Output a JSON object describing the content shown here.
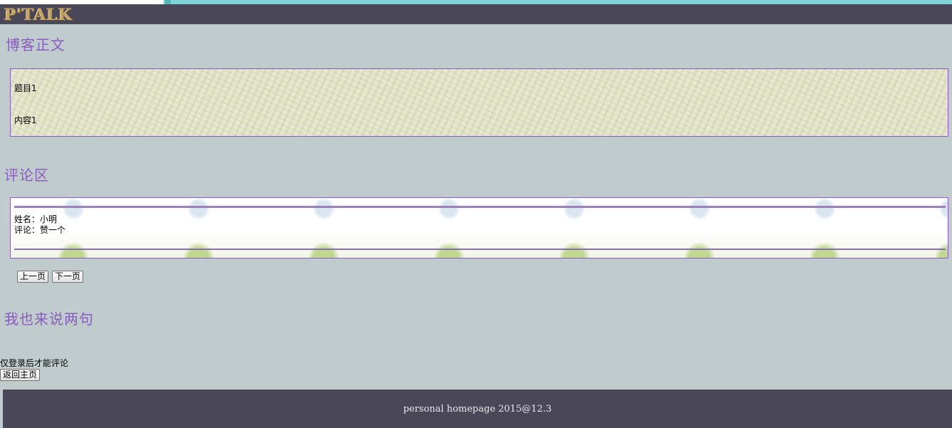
{
  "header": {
    "logo_text": "P'TALK"
  },
  "blog_section": {
    "title": "博客正文"
  },
  "post": {
    "title": "题目1",
    "content": "内容1"
  },
  "comments_section": {
    "title": "评论区"
  },
  "comments": [
    {
      "name_line": "姓名：小明",
      "comment_line": "评论：赞一个"
    }
  ],
  "pagination": {
    "prev_label": "上一页",
    "next_label": "下一页"
  },
  "say_section": {
    "title": "我也来说两句"
  },
  "login_note": "仅登录后才能评论",
  "home_button_label": "返回主页",
  "footer": {
    "text": "personal homepage 2015@12.3"
  },
  "colors": {
    "header_bg": "#4a4759",
    "page_bg": "#bfcbcc",
    "accent_purple": "#8a5bc0",
    "logo_gold": "#c7a56a"
  }
}
